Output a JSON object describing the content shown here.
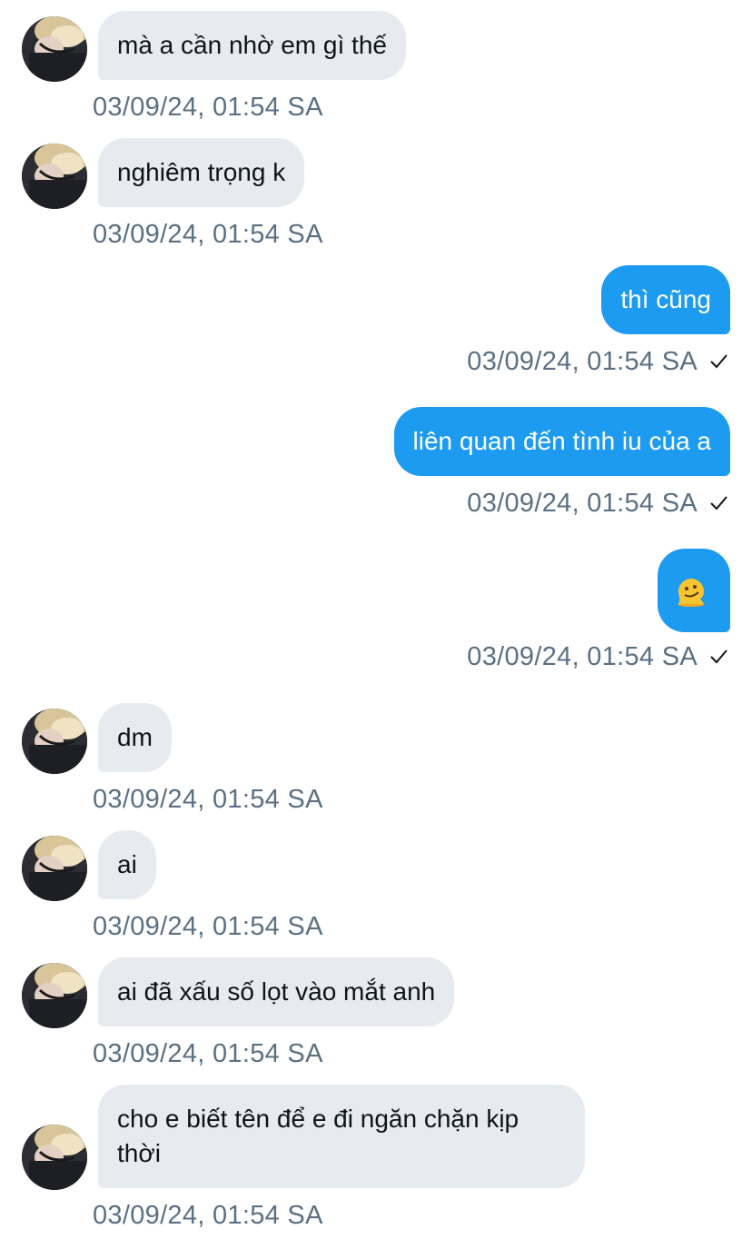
{
  "messages": [
    {
      "dir": "in",
      "text": "mà a cần nhờ em gì thế",
      "time": "03/09/24, 01:54 SA"
    },
    {
      "dir": "in",
      "text": "nghiêm trọng k",
      "time": "03/09/24, 01:54 SA"
    },
    {
      "dir": "out",
      "text": "thì cũng",
      "time": "03/09/24, 01:54 SA",
      "status": "sent-check-icon"
    },
    {
      "dir": "out",
      "text": "liên quan đến tình iu của a",
      "time": "03/09/24, 01:54 SA",
      "status": "sent-check-icon"
    },
    {
      "dir": "out",
      "text": "🫠",
      "emoji_name": "melting-face-emoji",
      "time": "03/09/24, 01:54 SA",
      "status": "sent-check-icon"
    },
    {
      "dir": "in",
      "text": "dm",
      "time": "03/09/24, 01:54 SA"
    },
    {
      "dir": "in",
      "text": "ai",
      "time": "03/09/24, 01:54 SA"
    },
    {
      "dir": "in",
      "text": "ai đã xấu số lọt vào mắt anh",
      "time": "03/09/24, 01:54 SA"
    },
    {
      "dir": "in",
      "text": "cho e biết tên để e đi ngăn chặn kịp thời",
      "time": "03/09/24, 01:54 SA"
    }
  ],
  "colors": {
    "incoming_bubble": "#e7ebef",
    "outgoing_bubble": "#1d9bf0",
    "timestamp": "#5b7083",
    "text": "#0f1419"
  }
}
